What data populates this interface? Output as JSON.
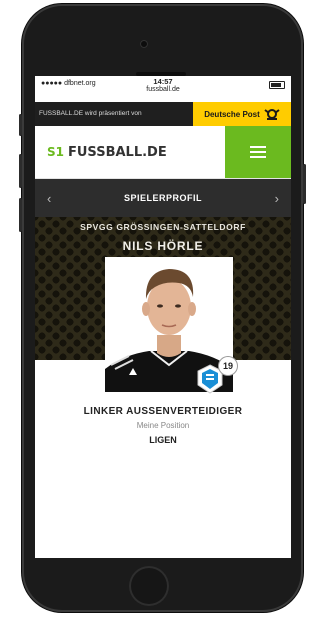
{
  "status_bar": {
    "carrier": "dfbnet.org",
    "time": "14:57",
    "url": "fussball.de"
  },
  "ad_bar": {
    "left_text": "FUSSBALL.DE wird präsentiert von",
    "sponsor": "Deutsche Post"
  },
  "header": {
    "logo_text": "FUSSBALL.DE",
    "logo_mark": "S1"
  },
  "profile_nav": {
    "prev": "‹",
    "title": "SPIELERPROFIL",
    "next": "›"
  },
  "player": {
    "club": "SPVGG GRÖSSINGEN-SATTELDORF",
    "name": "NILS HÖRLE",
    "number": "19"
  },
  "info": {
    "position": "LINKER AUSSENVERTEIDIGER",
    "position_sub": "Meine Position",
    "next_label": "LIGEN"
  },
  "colors": {
    "accent_green": "#6bba1f",
    "sponsor_yellow": "#ffcc00",
    "nav_dark": "#2d2d2d",
    "hero_bg": "#2e2a19"
  }
}
